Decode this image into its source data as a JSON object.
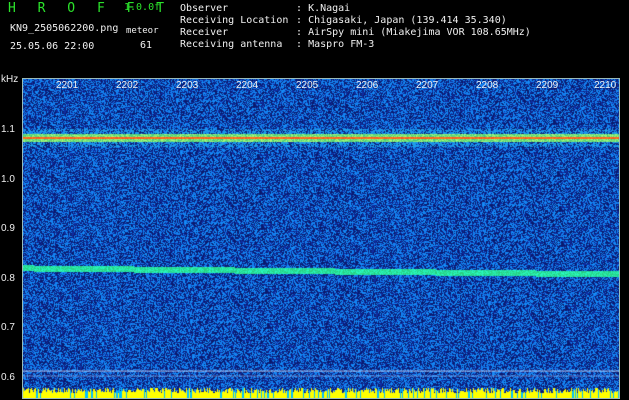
{
  "header": {
    "title": "H R O F F T",
    "version": "1.0.0f",
    "file_name": "KN9_2505062200.png",
    "meteor_label": "meteor",
    "meteor_count": "61",
    "datetime": "25.05.06 22:00",
    "info": [
      {
        "key": "Observer",
        "sep": ":",
        "value": "K.Nagai"
      },
      {
        "key": "Receiving Location",
        "sep": ":",
        "value": "Chigasaki, Japan (139.414 35.340)"
      },
      {
        "key": "Receiver",
        "sep": ":",
        "value": "AirSpy mini (Miakejima VOR 108.65MHz)"
      },
      {
        "key": "Receiving antenna",
        "sep": ":",
        "value": "Maspro FM-3"
      }
    ]
  },
  "spectrogram": {
    "y_unit": "kHz",
    "y_ticks": [
      "1.1",
      "1.0",
      "0.9",
      "0.8",
      "0.7",
      "0.6"
    ],
    "x_ticks": [
      "2201",
      "2202",
      "2203",
      "2204",
      "2205",
      "2206",
      "2207",
      "2208",
      "2209",
      "2210"
    ],
    "colors": {
      "background": "#0a1a6e",
      "noise": "#1e6ee6",
      "signal": "#ff3a20",
      "baseline": "#ffff00"
    }
  }
}
